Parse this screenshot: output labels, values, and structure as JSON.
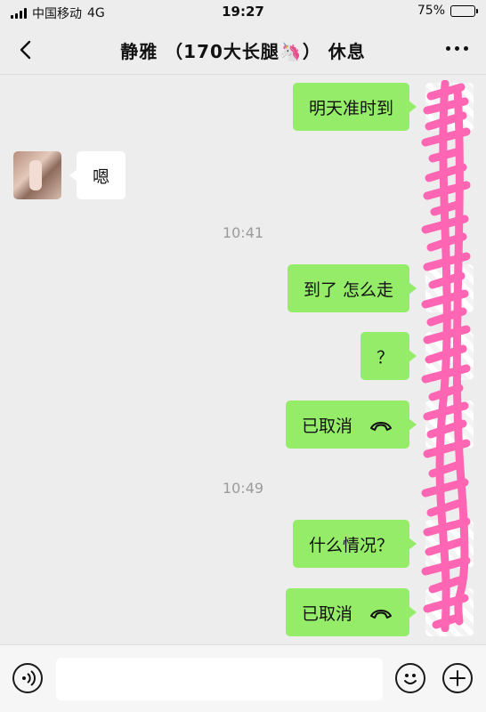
{
  "status_bar": {
    "carrier": "中国移动",
    "network": "4G",
    "time": "19:27",
    "battery_text": "75%",
    "battery_level": 0.75
  },
  "nav": {
    "back_icon": "chevron-left-icon",
    "title": "静雅 （170大长腿🦄） 休息",
    "more_icon": "ellipsis-icon"
  },
  "messages": [
    {
      "from": "me",
      "text": "明天准时到"
    },
    {
      "from": "them",
      "text": "嗯"
    },
    {
      "type": "time",
      "text": "10:41"
    },
    {
      "from": "me",
      "text": "到了 怎么走"
    },
    {
      "from": "me",
      "text": "？"
    },
    {
      "from": "me",
      "text": "已取消",
      "icon": "phone-hangup-icon"
    },
    {
      "type": "time",
      "text": "10:49"
    },
    {
      "from": "me",
      "text": "什么情况？"
    },
    {
      "from": "me",
      "text": "已取消",
      "icon": "phone-hangup-icon"
    }
  ],
  "input": {
    "value": "",
    "voice_icon": "voice-icon",
    "emoji_icon": "emoji-icon",
    "plus_icon": "plus-icon"
  },
  "colors": {
    "background": "#ededed",
    "my_bubble": "#95ec69",
    "their_bubble": "#ffffff",
    "redaction": "#ff5fb0"
  }
}
